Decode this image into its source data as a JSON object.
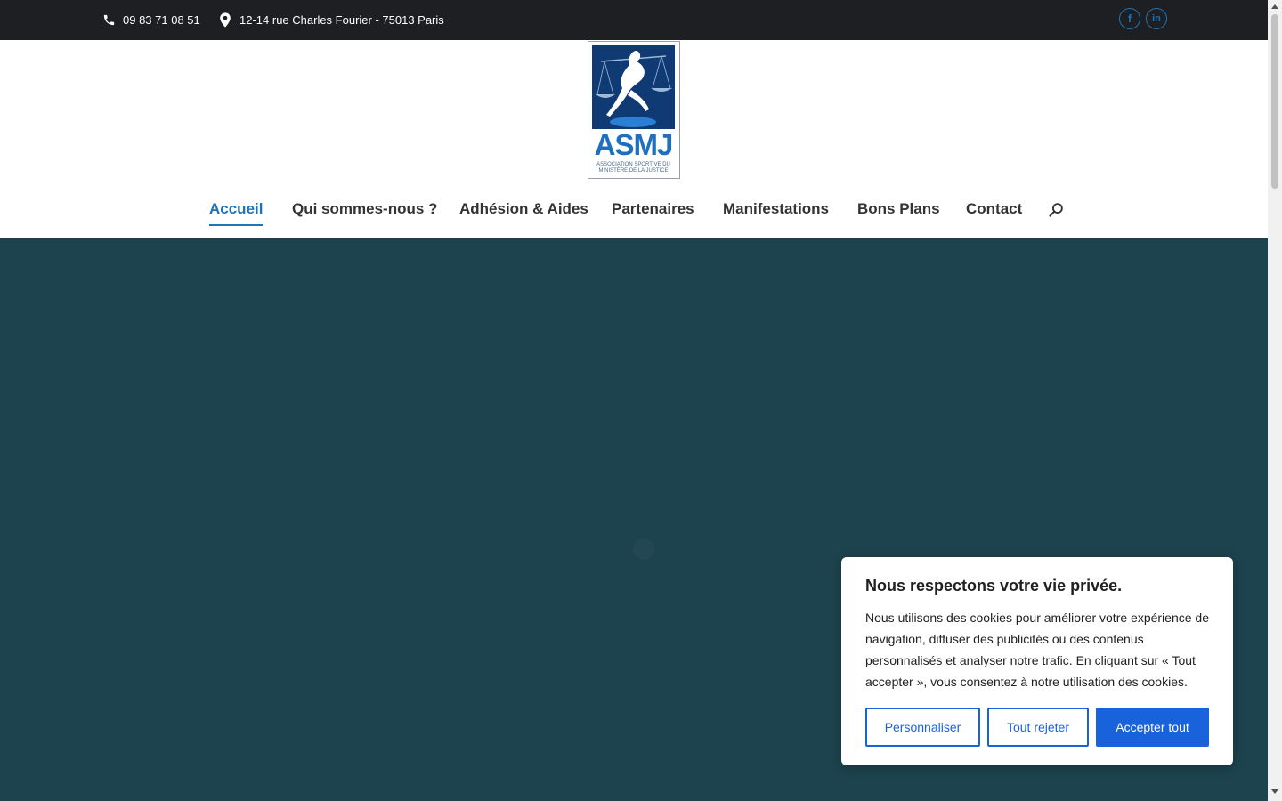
{
  "topbar": {
    "phone": "09 83 71 08 51",
    "address": "12-14 rue Charles Fourier - 75013 Paris",
    "social": [
      {
        "name": "facebook-icon",
        "glyph": "f"
      },
      {
        "name": "linkedin-icon",
        "glyph": "in"
      }
    ]
  },
  "logo": {
    "letters": "ASMJ",
    "subtitle_line1": "ASSOCIATION SPORTIVE DU",
    "subtitle_line2": "MINISTÈRE DE LA JUSTICE"
  },
  "nav": {
    "items": [
      {
        "label": "Accueil",
        "active": true
      },
      {
        "label": "Qui sommes-nous ?",
        "active": false
      },
      {
        "label": "Adhésion & Aides",
        "active": false
      },
      {
        "label": "Partenaires",
        "active": false
      },
      {
        "label": "Manifestations",
        "active": false
      },
      {
        "label": "Bons Plans",
        "active": false
      },
      {
        "label": "Contact",
        "active": false
      }
    ],
    "search_icon": "search-icon"
  },
  "cookie": {
    "title": "Nous respectons votre vie privée.",
    "text": "Nous utilisons des cookies pour améliorer votre expérience de navigation, diffuser des publicités ou des contenus personnalisés et analyser notre trafic. En cliquant sur « Tout accepter », vous consentez à notre utilisation des cookies.",
    "customize_label": "Personnaliser",
    "reject_label": "Tout rejeter",
    "accept_label": "Accepter tout"
  },
  "colors": {
    "accent": "#1f73b7",
    "topbar": "#1e1f22",
    "hero": "#1c434e",
    "cookie_button": "#1863dc"
  }
}
